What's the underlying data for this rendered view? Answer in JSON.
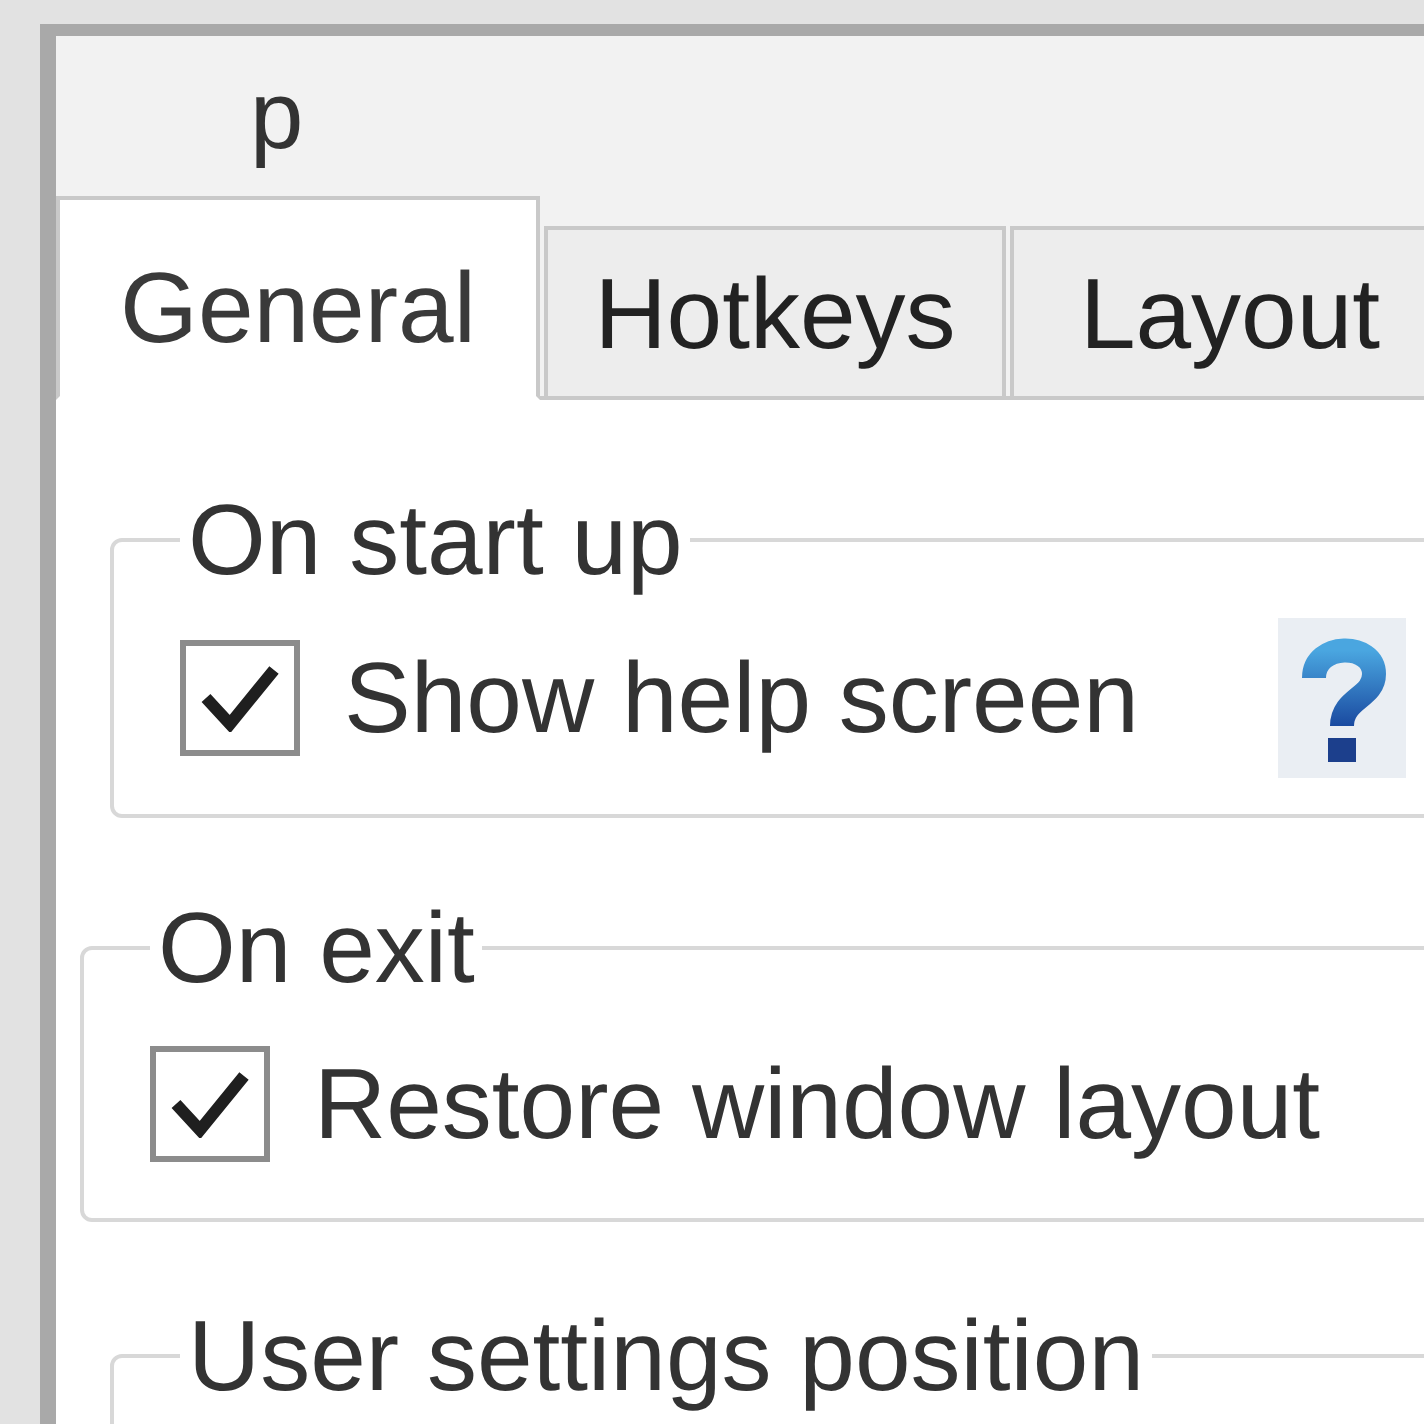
{
  "window": {
    "title": "p"
  },
  "tabs": [
    {
      "label": "General",
      "selected": true
    },
    {
      "label": "Hotkeys",
      "selected": false
    },
    {
      "label": "Layout",
      "selected": false
    }
  ],
  "groups": [
    {
      "title": "On start up",
      "options": [
        {
          "label": "Show help screen",
          "checked": true,
          "help": true
        }
      ]
    },
    {
      "title": "On exit",
      "options": [
        {
          "label": "Restore window layout",
          "checked": true,
          "help": false
        }
      ]
    },
    {
      "title": "User settings position"
    }
  ]
}
